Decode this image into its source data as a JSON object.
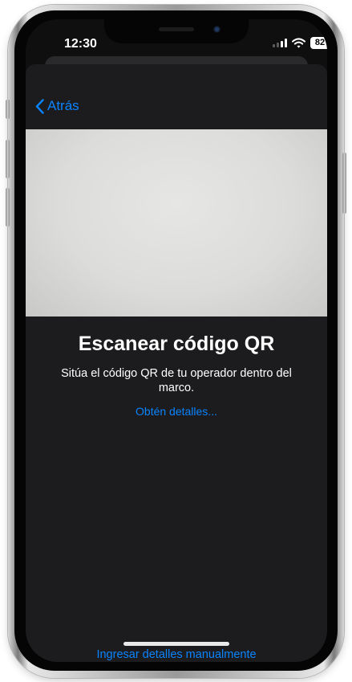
{
  "status_bar": {
    "time": "12:30",
    "battery": "82",
    "icons": [
      "signal-icon",
      "wifi-icon",
      "battery-icon"
    ]
  },
  "nav": {
    "back_label": "Atrás",
    "back_icon": "chevron-left-icon"
  },
  "scanner": {
    "title": "Escanear código QR",
    "subtitle": "Sitúa el código QR de tu operador dentro del marco.",
    "details_link": "Obtén detalles...",
    "manual_link": "Ingresar detalles manualmente"
  },
  "colors": {
    "accent": "#0a84ff",
    "background": "#1c1c1e",
    "text": "#ffffff"
  }
}
